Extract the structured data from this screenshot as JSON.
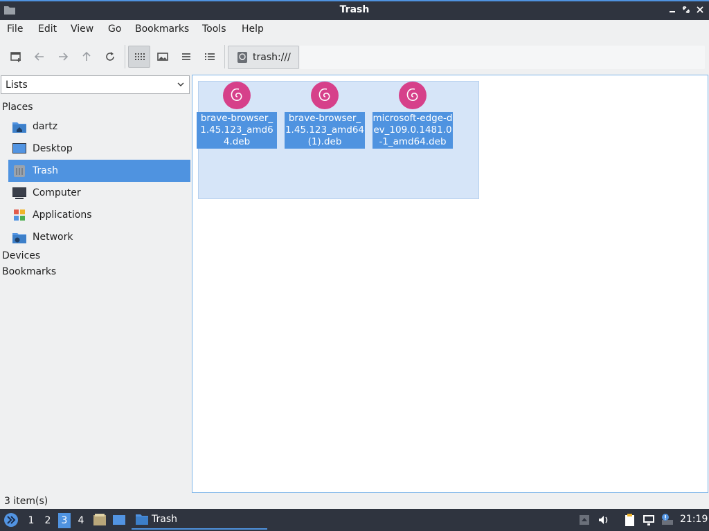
{
  "window": {
    "title": "Trash"
  },
  "menubar": {
    "items": [
      "File",
      "Edit",
      "View",
      "Go",
      "Bookmarks",
      "Tools",
      "Help"
    ]
  },
  "toolbar": {
    "path_button_label": "trash:///"
  },
  "sidebar": {
    "selector_value": "Lists",
    "headings": {
      "places": "Places",
      "devices": "Devices",
      "bookmarks": "Bookmarks"
    },
    "items": [
      {
        "label": "dartz",
        "icon": "home-folder-icon"
      },
      {
        "label": "Desktop",
        "icon": "desktop-icon"
      },
      {
        "label": "Trash",
        "icon": "trash-icon",
        "selected": true
      },
      {
        "label": "Computer",
        "icon": "computer-icon"
      },
      {
        "label": "Applications",
        "icon": "applications-icon"
      },
      {
        "label": "Network",
        "icon": "network-folder-icon"
      }
    ]
  },
  "files": [
    {
      "name": "brave-browser_1.45.123_amd64.deb",
      "icon": "debian-package-icon"
    },
    {
      "name": "brave-browser_1.45.123_amd64(1).deb",
      "icon": "debian-package-icon"
    },
    {
      "name": "microsoft-edge-dev_109.0.1481.0-1_amd64.deb",
      "icon": "debian-package-icon"
    }
  ],
  "statusbar": {
    "text": "3 item(s)"
  },
  "taskbar": {
    "workspaces": [
      "1",
      "2",
      "3",
      "4"
    ],
    "active_workspace": "3",
    "task_label": "Trash",
    "clock": "21:19"
  },
  "colors": {
    "accent": "#4f93e0",
    "panel": "#2f343f",
    "debian": "#d6408a"
  }
}
